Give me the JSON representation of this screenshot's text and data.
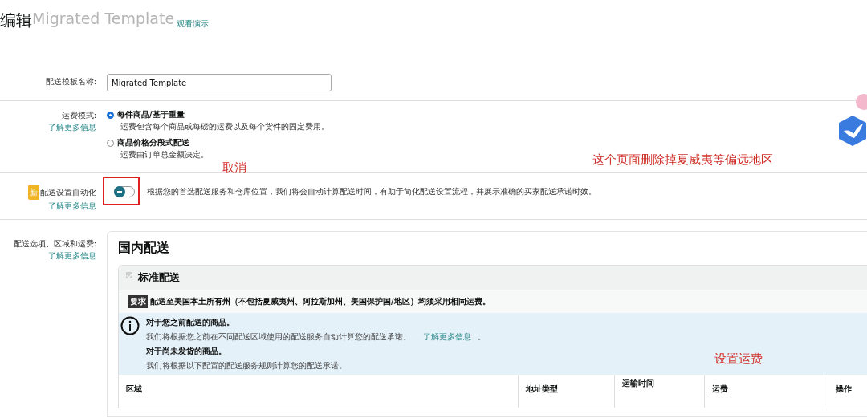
{
  "header": {
    "title_prefix": "编辑",
    "title_name": "Migrated Template",
    "demo_link": "观看演示"
  },
  "template_name": {
    "label": "配送模板名称:",
    "value": "Migrated Template"
  },
  "freight_mode": {
    "label": "运费模式:",
    "link": "了解更多信息",
    "options": [
      {
        "title": "每件商品/基于重量",
        "desc": "运费包含每个商品或每磅的运费以及每个货件的固定费用。",
        "selected": true
      },
      {
        "title": "商品价格分段式配送",
        "desc": "运费由订单总金额决定。",
        "selected": false
      }
    ]
  },
  "automation": {
    "badge": "新",
    "label": "配送设置自动化",
    "link": "了解更多信息",
    "on": false,
    "desc": "根据您的首选配送服务和仓库位置，我们将会自动计算配送时间，有助于简化配送设置流程，并展示准确的买家配送承诺时效。"
  },
  "shipping": {
    "label": "配送选项、区域和运费:",
    "link": "了解更多信息",
    "section_title": "国内配送",
    "standard": {
      "title": "标准配送",
      "checked": true,
      "requirement_tag": "要求",
      "requirement": "配送至美国本土所有州（不包括夏威夷州、阿拉斯加州、美国保护国/地区）均须采用相同运费。",
      "info": {
        "heading_1": "对于您之前配送的商品。",
        "text_1": "我们将根据您之前在不同配送区域使用的配送服务自动计算您的配送承诺。",
        "link": "了解更多信息",
        "text_1_end": "。",
        "heading_2": "对于尚未发货的商品。",
        "text_2": "我们将根据以下配置的配送服务规则计算您的配送承诺。"
      },
      "columns": [
        "区域",
        "地址类型",
        "运输时间",
        "运费",
        "操作"
      ]
    }
  },
  "annotations": [
    {
      "kind": "box",
      "text": "取消"
    },
    {
      "kind": "note",
      "text": "这个页面删除掉夏威夷等偏远地区"
    },
    {
      "kind": "note",
      "text": "设置运费"
    }
  ]
}
